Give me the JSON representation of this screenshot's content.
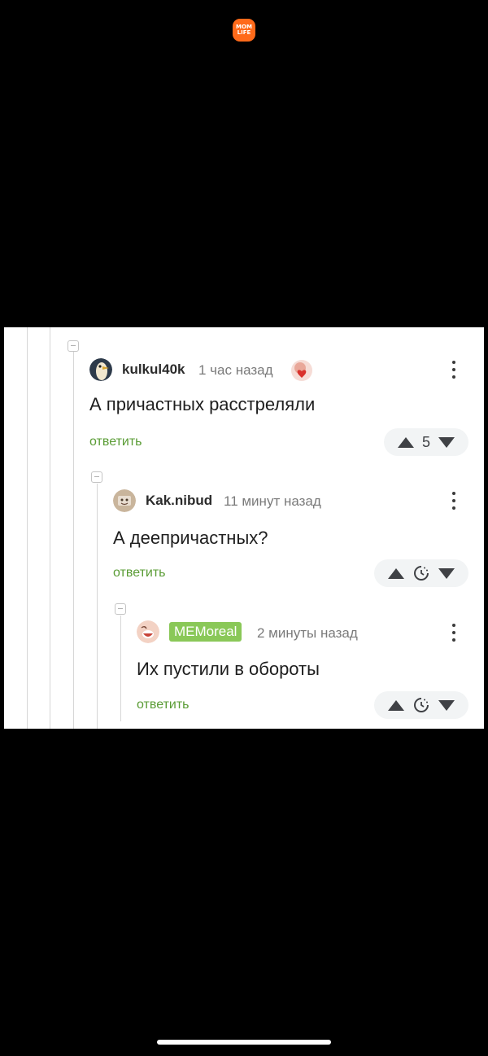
{
  "app_logo": {
    "line1": "MOM",
    "line2": "LIFE",
    "color": "#ff6a1a"
  },
  "comments": [
    {
      "author": "kulkul40k",
      "timestamp": "1 час назад",
      "text": "А причастных расстреляли",
      "reply_label": "ответить",
      "score": "5",
      "avatar_icon": "bird-avatar",
      "badge_icon": "heart-award-icon"
    },
    {
      "author": "Kak.nibud",
      "timestamp": "11 минут назад",
      "text": "А деепричастных?",
      "reply_label": "ответить",
      "score": "",
      "avatar_icon": "photo-avatar",
      "score_icon": "timer-icon"
    },
    {
      "author": "MEMoreal",
      "timestamp": "2 минуты назад",
      "text": "Их пустили в обороты",
      "reply_label": "ответить",
      "score": "",
      "avatar_icon": "face-avatar",
      "score_icon": "timer-icon",
      "author_badge_color": "#8ac858"
    }
  ],
  "colors": {
    "reply_link": "#5a9c35",
    "thread_line": "#d6d6d6",
    "vote_bg": "#f2f4f5"
  }
}
